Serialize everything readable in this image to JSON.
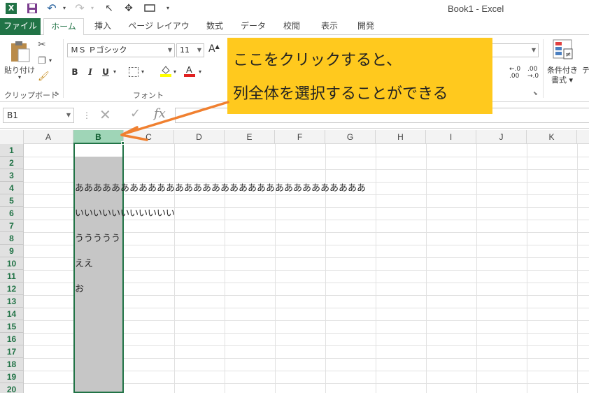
{
  "titlebar": {
    "title": "Book1 - Excel"
  },
  "tabs": [
    {
      "label": "ファイル"
    },
    {
      "label": "ホーム"
    },
    {
      "label": "挿入"
    },
    {
      "label": "ページ レイアウト"
    },
    {
      "label": "数式"
    },
    {
      "label": "データ"
    },
    {
      "label": "校閲"
    },
    {
      "label": "表示"
    },
    {
      "label": "開発"
    }
  ],
  "ribbon": {
    "paste_label": "貼り付け",
    "clipboard_group": "クリップボード",
    "font_group": "フォント",
    "font_name": "ＭＳ Ｐゴシック",
    "font_size": "11",
    "bold": "B",
    "italic": "I",
    "underline": "U",
    "conditional_format_label": "条件付き",
    "conditional_format_label2": "書式",
    "next_label": "テ"
  },
  "formula_bar": {
    "name_box": "B1",
    "fx": "fx"
  },
  "columns": [
    "A",
    "B",
    "C",
    "D",
    "E",
    "F",
    "G",
    "H",
    "I",
    "J",
    "K"
  ],
  "rows": [
    "1",
    "2",
    "3",
    "4",
    "5",
    "6",
    "7",
    "8",
    "9",
    "10",
    "11",
    "12",
    "13",
    "14",
    "15",
    "16",
    "17",
    "18",
    "19",
    "20"
  ],
  "cells": {
    "b4": "ああああああああああああああああああああああああああああああああ",
    "b6": "いいいいいいいいいいい",
    "b8": "ううううう",
    "b10": "ええ",
    "b12": "お"
  },
  "callout": {
    "line1": "ここをクリックすると、",
    "line2": "列全体を選択することができる"
  },
  "colors": {
    "accent": "#217346",
    "callout_bg": "#ffc91e",
    "arrow": "#f08030"
  }
}
